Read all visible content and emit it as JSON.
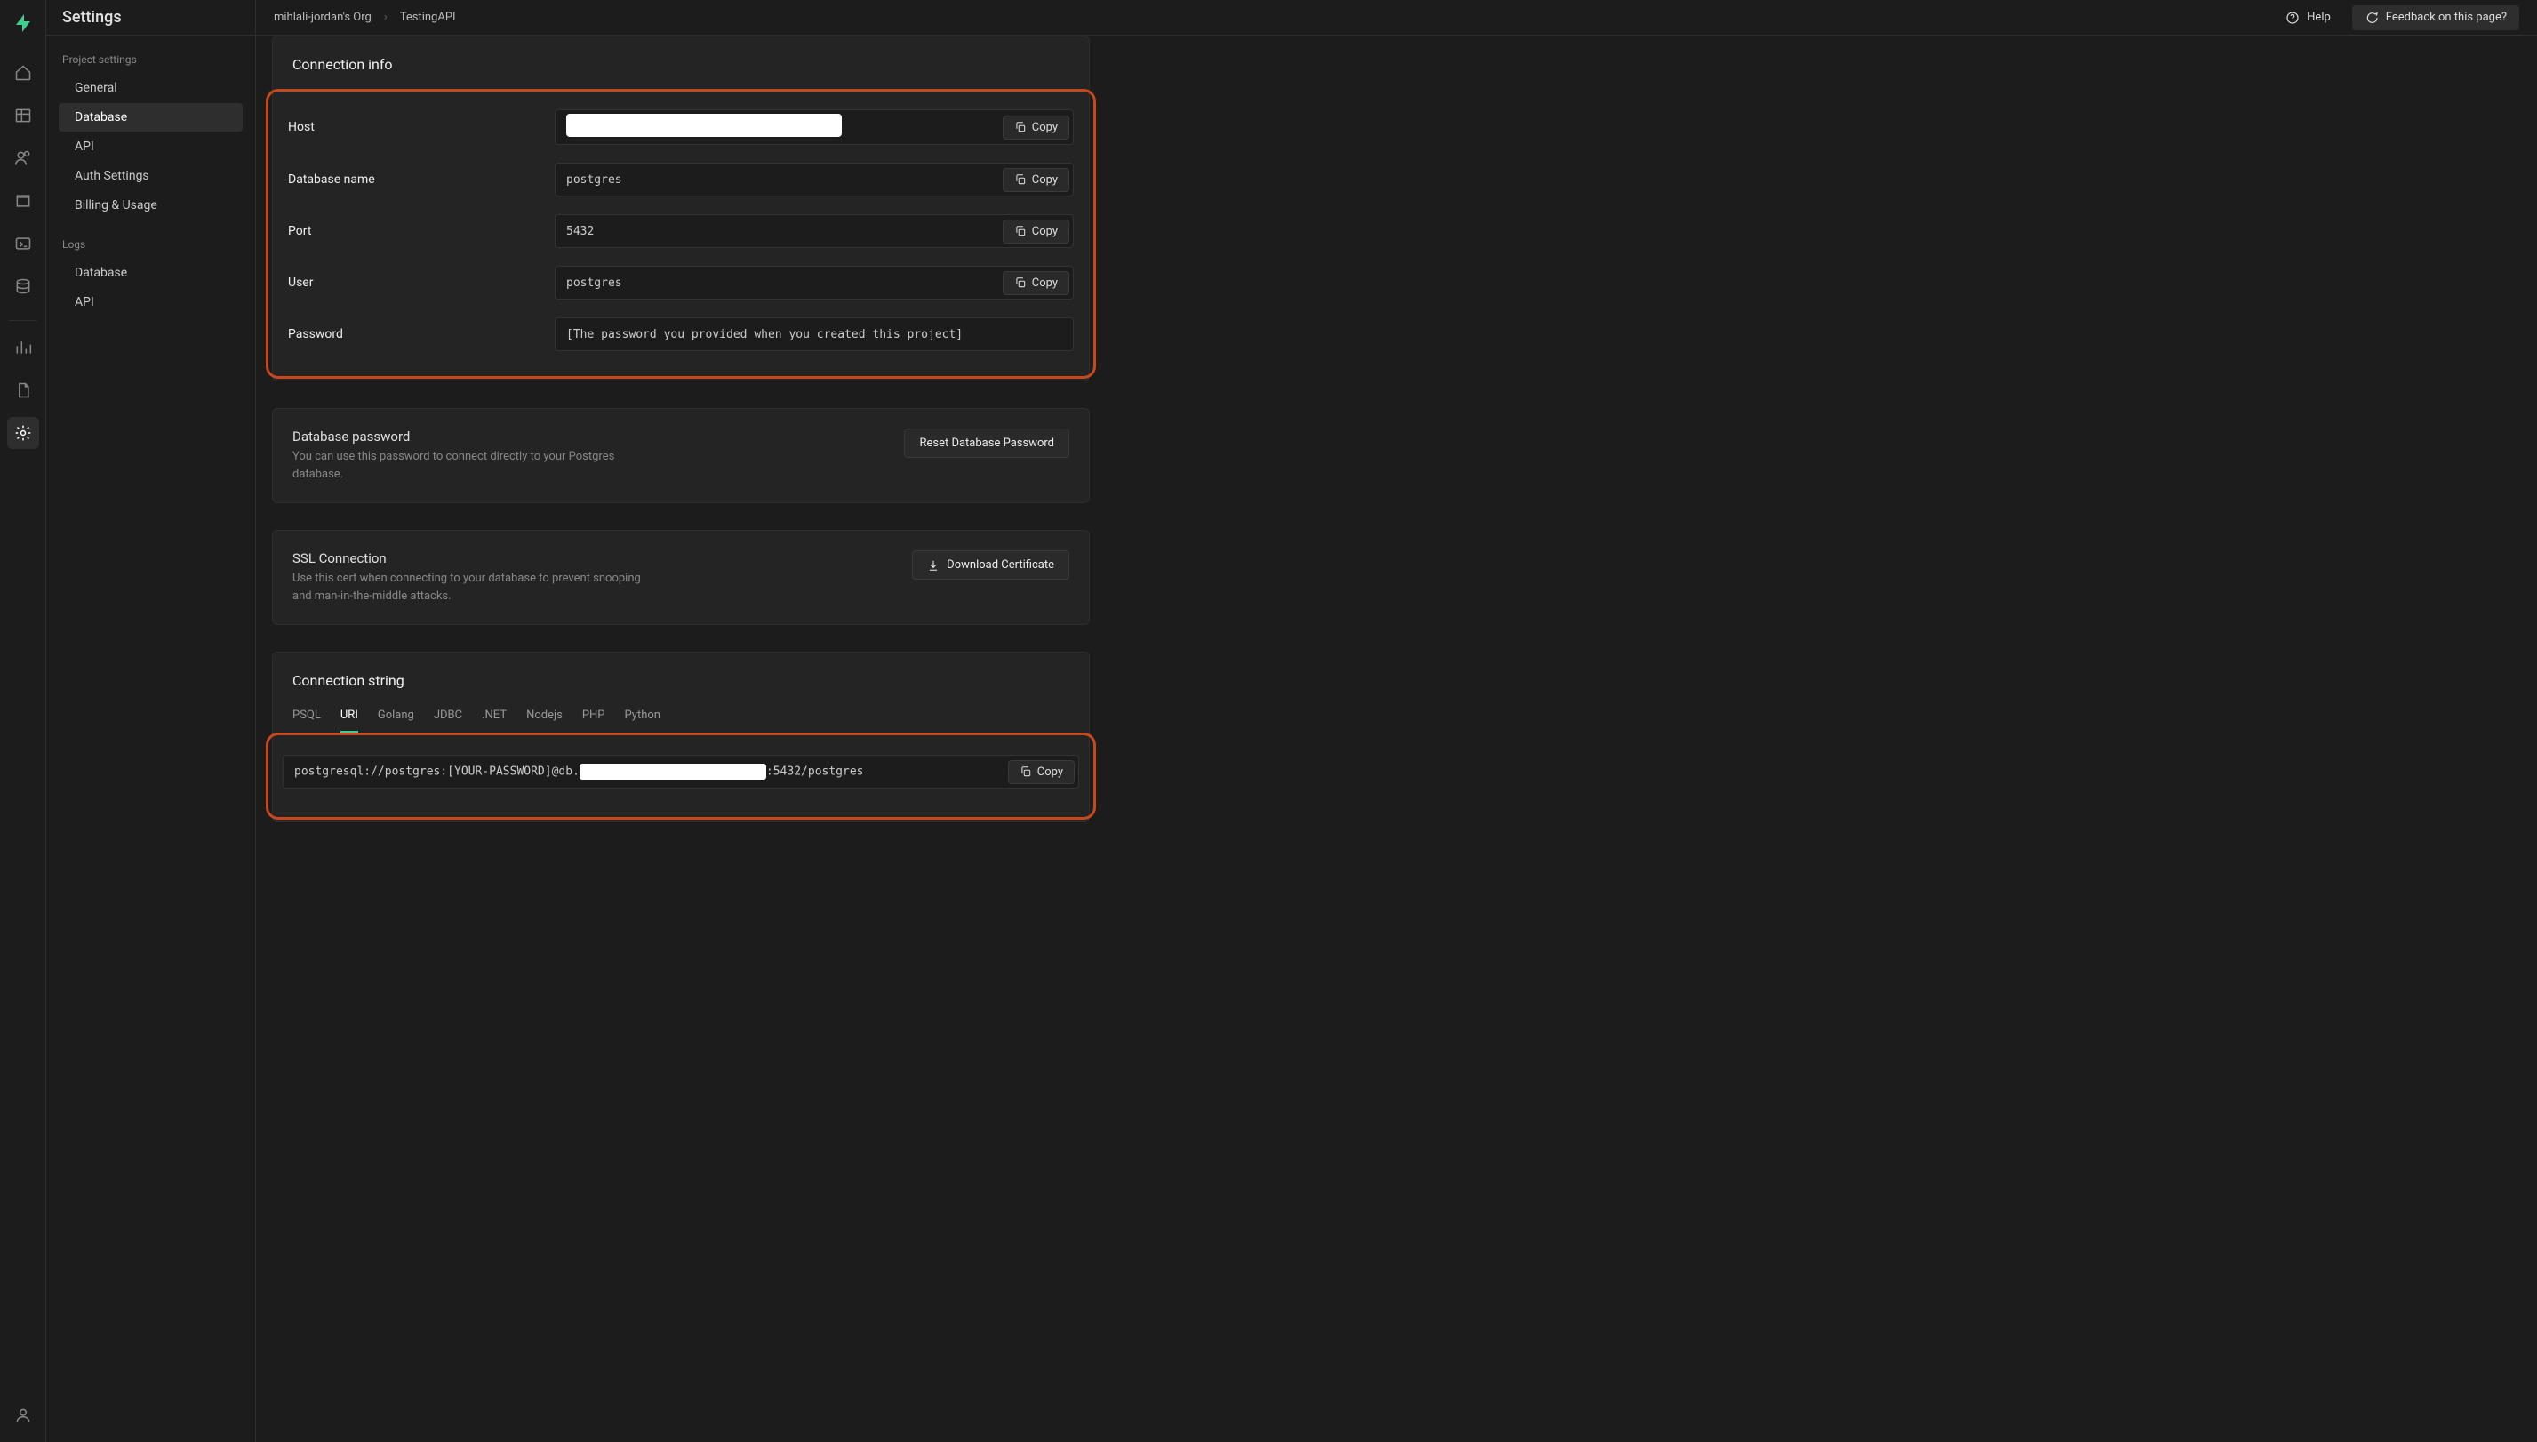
{
  "page_title": "Settings",
  "breadcrumb": {
    "org": "mihlali-jordan's Org",
    "project": "TestingAPI"
  },
  "topbar": {
    "help": "Help",
    "feedback": "Feedback on this page?"
  },
  "sidebar": {
    "section1_title": "Project settings",
    "items1": [
      "General",
      "Database",
      "API",
      "Auth Settings",
      "Billing & Usage"
    ],
    "section2_title": "Logs",
    "items2": [
      "Database",
      "API"
    ]
  },
  "connection_info": {
    "title": "Connection info",
    "copy": "Copy",
    "rows": {
      "host_label": "Host",
      "dbname_label": "Database name",
      "dbname_value": "postgres",
      "port_label": "Port",
      "port_value": "5432",
      "user_label": "User",
      "user_value": "postgres",
      "password_label": "Password",
      "password_value": "[The password you provided when you created this project]"
    }
  },
  "db_password": {
    "title": "Database password",
    "desc": "You can use this password to connect directly to your Postgres database.",
    "action": "Reset Database Password"
  },
  "ssl": {
    "title": "SSL Connection",
    "desc": "Use this cert when connecting to your database to prevent snooping and man-in-the-middle attacks.",
    "action": "Download Certificate"
  },
  "conn_string": {
    "title": "Connection string",
    "tabs": [
      "PSQL",
      "URI",
      "Golang",
      "JDBC",
      ".NET",
      "Nodejs",
      "PHP",
      "Python"
    ],
    "active_tab": "URI",
    "prefix": "postgresql://postgres:[YOUR-PASSWORD]@db.",
    "suffix": ":5432/postgres",
    "copy": "Copy"
  }
}
